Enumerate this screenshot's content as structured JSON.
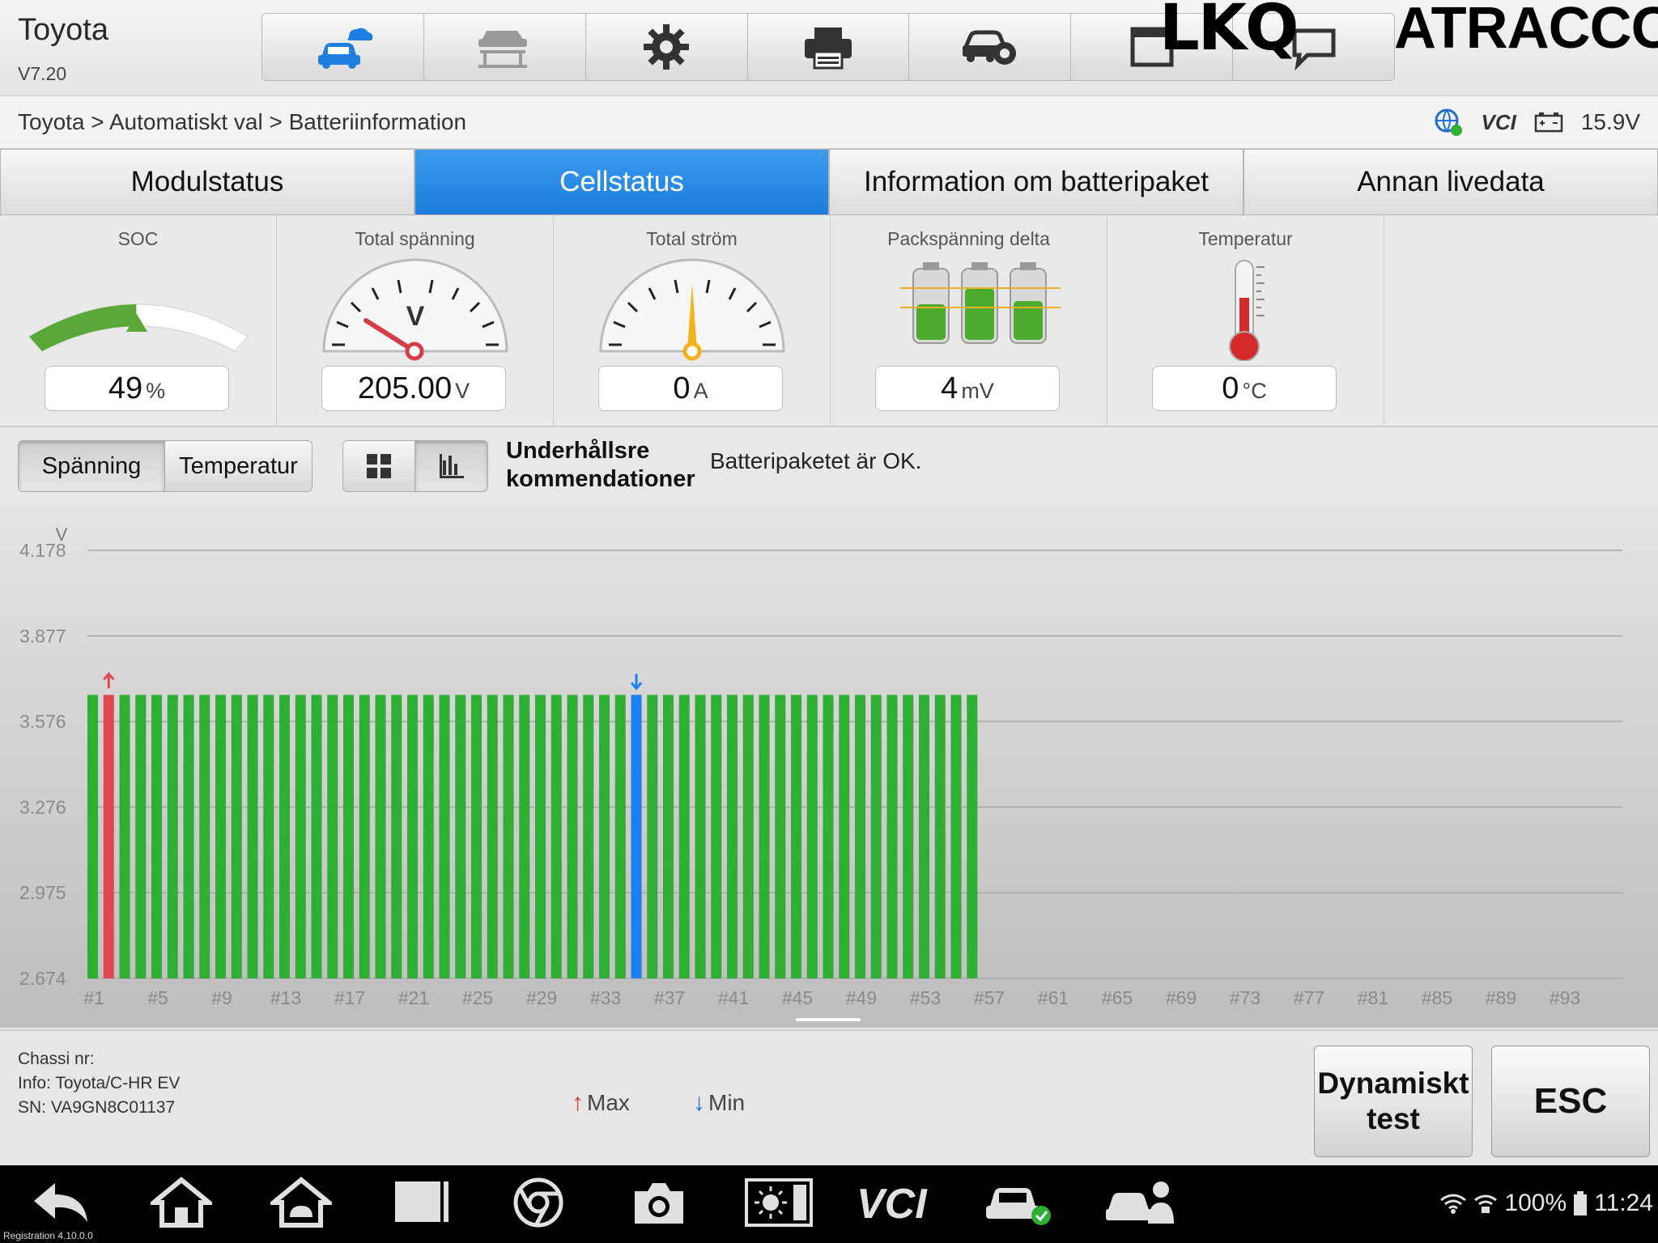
{
  "header": {
    "app_title": "Toyota",
    "version": "V7.20",
    "brand_left": "LKQ",
    "brand_right": "ATRACCO",
    "toolbar_icons": [
      "car-cloud-icon",
      "vehicle-lift-icon",
      "gear-icon",
      "printer-icon",
      "car-info-icon",
      "window-icon",
      "chat-icon"
    ]
  },
  "breadcrumb": {
    "path": "Toyota > Automatiskt val > Batteriinformation",
    "vci": "VCI",
    "voltage": "15.9V"
  },
  "tabs": [
    {
      "label": "Modulstatus",
      "active": false
    },
    {
      "label": "Cellstatus",
      "active": true
    },
    {
      "label": "Information om batteripaket",
      "active": false
    },
    {
      "label": "Annan livedata",
      "active": false
    }
  ],
  "gauges": {
    "soc": {
      "title": "SOC",
      "value": "49",
      "unit": "%",
      "level": 0.49
    },
    "voltage": {
      "title": "Total spänning",
      "value": "205.00",
      "unit": "V",
      "dial_letter": "V"
    },
    "current": {
      "title": "Total ström",
      "value": "0",
      "unit": "A"
    },
    "delta": {
      "title": "Packspänning delta",
      "value": "4",
      "unit": "mV"
    },
    "temperature": {
      "title": "Temperatur",
      "value": "0",
      "unit": "°C"
    }
  },
  "controls": {
    "voltage_btn": "Spänning",
    "temperature_btn": "Temperatur",
    "grid_view_icon": "grid-view-icon",
    "bar_view_icon": "bar-chart-icon",
    "maintenance_label_line1": "Underhållsre",
    "maintenance_label_line2": "kommendationer",
    "maintenance_text": "Batteripaketet är OK."
  },
  "chart_data": {
    "type": "bar",
    "ylabel": "V",
    "yticks": [
      "4.178",
      "3.877",
      "3.576",
      "3.276",
      "2.975",
      "2.674"
    ],
    "ylim": [
      2.674,
      4.178
    ],
    "cell_slots": 96,
    "xtick_labels": [
      "#1",
      "#5",
      "#9",
      "#13",
      "#17",
      "#21",
      "#25",
      "#29",
      "#33",
      "#37",
      "#41",
      "#45",
      "#49",
      "#53",
      "#57",
      "#61",
      "#65",
      "#69",
      "#73",
      "#77",
      "#81",
      "#85",
      "#89",
      "#93"
    ],
    "cell_count": 56,
    "cell_voltage": 3.67,
    "max_cell": 2,
    "min_cell": 35,
    "colors": {
      "normal": "#2eae32",
      "max": "#e0474c",
      "min": "#1a7ff0",
      "grid": "#a8a8a8",
      "tick": "#8a8a8a"
    }
  },
  "footer": {
    "chassis_label": "Chassi nr:",
    "info": "Info: Toyota/C-HR EV",
    "sn": "SN: VA9GN8C01137",
    "legend_max": "Max",
    "legend_min": "Min",
    "dyn_line1": "Dynamiskt",
    "dyn_line2": "test",
    "esc": "ESC"
  },
  "navbar": {
    "registration": "Registration 4.10.0.0",
    "battery": "100%",
    "time": "11:24",
    "vci": "VCI"
  }
}
